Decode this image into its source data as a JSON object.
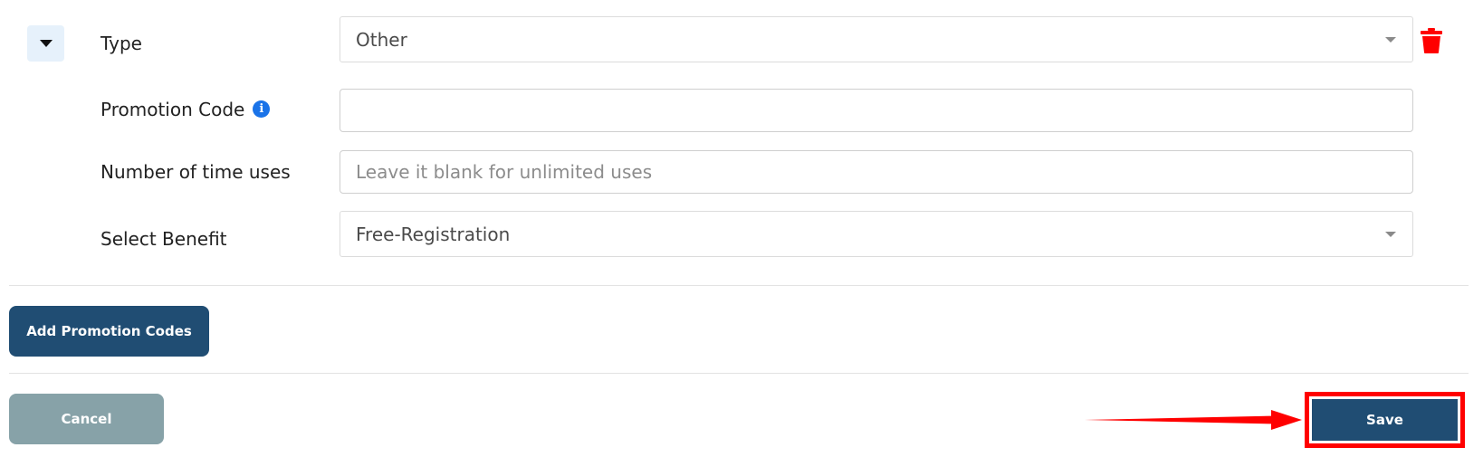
{
  "form": {
    "type_row": {
      "label": "Type",
      "value": "Other"
    },
    "promotion_code_row": {
      "label": "Promotion Code",
      "info_icon": "info-icon",
      "value": ""
    },
    "uses_row": {
      "label": "Number of time uses",
      "placeholder": "Leave it blank for unlimited uses",
      "value": ""
    },
    "benefit_row": {
      "label": "Select Benefit",
      "value": "Free-Registration"
    }
  },
  "actions": {
    "add_label": "Add Promotion Codes",
    "cancel_label": "Cancel",
    "save_label": "Save"
  },
  "icons": {
    "collapse": "caret-down-icon",
    "delete": "trash-icon",
    "select_caret": "chevron-down-icon"
  },
  "colors": {
    "primary_button": "#204d73",
    "cancel_button": "#87a2a8",
    "delete_icon": "#ff0000",
    "highlight": "#ff0000",
    "info_icon": "#1a73e8",
    "collapse_bg": "#e6f1fb"
  }
}
